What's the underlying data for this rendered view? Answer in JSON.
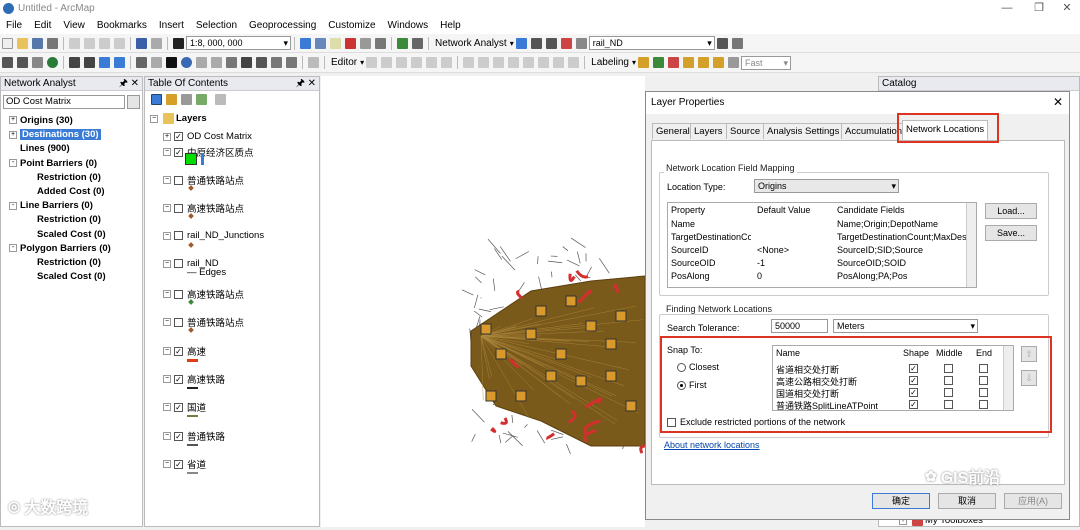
{
  "app": {
    "title": "Untitled - ArcMap"
  },
  "menu": [
    "File",
    "Edit",
    "View",
    "Bookmarks",
    "Insert",
    "Selection",
    "Geoprocessing",
    "Customize",
    "Windows",
    "Help"
  ],
  "toolbar": {
    "scale": "1:8, 000, 000",
    "network_analyst_label": "Network Analyst",
    "network_dataset": "rail_ND",
    "editor_label": "Editor",
    "labeling_label": "Labeling",
    "fast_label": "Fast"
  },
  "network_analyst_window": {
    "title": "Network Analyst",
    "layer_select": "OD Cost Matrix",
    "items": [
      {
        "label": "Origins (30)",
        "level": 0,
        "expand": "+"
      },
      {
        "label": "Destinations (30)",
        "level": 0,
        "expand": "+",
        "selected": true
      },
      {
        "label": "Lines (900)",
        "level": 0,
        "expand": ""
      },
      {
        "label": "Point Barriers (0)",
        "level": 0,
        "expand": "-"
      },
      {
        "label": "Restriction (0)",
        "level": 1
      },
      {
        "label": "Added Cost (0)",
        "level": 1
      },
      {
        "label": "Line Barriers (0)",
        "level": 0,
        "expand": "-"
      },
      {
        "label": "Restriction (0)",
        "level": 1
      },
      {
        "label": "Scaled Cost (0)",
        "level": 1
      },
      {
        "label": "Polygon Barriers (0)",
        "level": 0,
        "expand": "-"
      },
      {
        "label": "Restriction (0)",
        "level": 1
      },
      {
        "label": "Scaled Cost (0)",
        "level": 1
      }
    ]
  },
  "toc": {
    "title": "Table Of Contents",
    "root": "Layers",
    "layers": [
      {
        "label": "OD Cost Matrix",
        "checked": true
      },
      {
        "label": "中原经济区质点",
        "checked": true
      },
      {
        "label": "普通铁路站点",
        "checked": false
      },
      {
        "label": "高速铁路站点",
        "checked": false
      },
      {
        "label": "rail_ND_Junctions",
        "checked": false
      },
      {
        "label": "rail_ND",
        "checked": false,
        "sub": "Edges"
      },
      {
        "label": "高速铁路站点",
        "checked": false
      },
      {
        "label": "普通铁路站点",
        "checked": false
      },
      {
        "label": "高速",
        "checked": true
      },
      {
        "label": "高速铁路",
        "checked": true
      },
      {
        "label": "国道",
        "checked": true
      },
      {
        "label": "普通铁路",
        "checked": true
      },
      {
        "label": "省道",
        "checked": true
      }
    ]
  },
  "catalog": {
    "title": "Catalog",
    "toolboxes": "My Toolboxes"
  },
  "dialog": {
    "title": "Layer Properties",
    "tabs": [
      "General",
      "Layers",
      "Source",
      "Analysis Settings",
      "Accumulation",
      "Network Locations"
    ],
    "mapping_group": "Network Location Field Mapping",
    "location_type_label": "Location Type:",
    "location_type_value": "Origins",
    "grid_headers": [
      "Property",
      "Default Value",
      "Candidate Fields"
    ],
    "grid_rows": [
      [
        "Name",
        "",
        "Name;Origin;DepotName"
      ],
      [
        "TargetDestinationCo...",
        "",
        "TargetDestinationCount;MaxDes..."
      ],
      [
        "SourceID",
        "<None>",
        "SourceID;SID;Source"
      ],
      [
        "SourceOID",
        "-1",
        "SourceOID;SOID"
      ],
      [
        "PosAlong",
        "0",
        "PosAlong;PA;Pos"
      ]
    ],
    "load_button": "Load...",
    "save_button": "Save...",
    "finding_group": "Finding Network Locations",
    "tolerance_label": "Search Tolerance:",
    "tolerance_value": "50000",
    "tolerance_unit": "Meters",
    "snap_label": "Snap To:",
    "closest_label": "Closest",
    "first_label": "First",
    "snap_headers": [
      "Name",
      "Shape",
      "Middle",
      "End"
    ],
    "snap_rows": [
      {
        "name": "省道相交处打断",
        "shape": true
      },
      {
        "name": "高速公路相交处打断",
        "shape": true
      },
      {
        "name": "国道相交处打断",
        "shape": true
      },
      {
        "name": "普通铁路SplitLineATPoint",
        "shape": true
      }
    ],
    "exclude_label": "Exclude restricted portions of the network",
    "about_link": "About network locations",
    "ok_button": "确定",
    "cancel_button": "取消",
    "apply_button": "应用(A)"
  },
  "watermarks": {
    "left": "大数跨境",
    "right": "GIS前沿"
  },
  "colors": {
    "accent_red": "#d32f2f",
    "selected_bg": "#3a7bd5",
    "map_fill": "#7a5a1a"
  }
}
